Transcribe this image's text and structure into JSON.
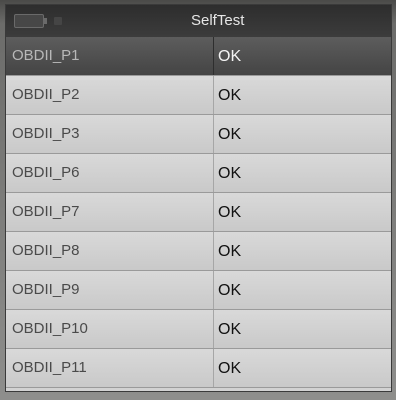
{
  "window": {
    "title": "SelfTest"
  },
  "icons": {
    "battery": "battery-icon",
    "signal": "signal-icon"
  },
  "colors": {
    "titlebar": "#333333",
    "selected_row": "#4f4f4f",
    "row": "#d2d2d2"
  },
  "tests": [
    {
      "name": "OBDII_P1",
      "status": "OK",
      "selected": true
    },
    {
      "name": "OBDII_P2",
      "status": "OK",
      "selected": false
    },
    {
      "name": "OBDII_P3",
      "status": "OK",
      "selected": false
    },
    {
      "name": "OBDII_P6",
      "status": "OK",
      "selected": false
    },
    {
      "name": "OBDII_P7",
      "status": "OK",
      "selected": false
    },
    {
      "name": "OBDII_P8",
      "status": "OK",
      "selected": false
    },
    {
      "name": "OBDII_P9",
      "status": "OK",
      "selected": false
    },
    {
      "name": "OBDII_P10",
      "status": "OK",
      "selected": false
    },
    {
      "name": "OBDII_P11",
      "status": "OK",
      "selected": false
    }
  ]
}
